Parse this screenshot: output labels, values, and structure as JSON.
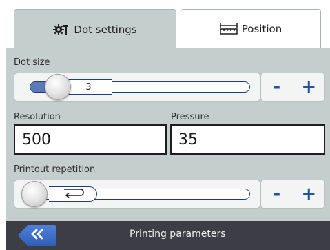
{
  "tabs": [
    {
      "label": "Dot settings",
      "icon": "gears-icon",
      "active": true
    },
    {
      "label": "Position",
      "icon": "ruler-icon",
      "active": false
    }
  ],
  "dot_size": {
    "label": "Dot size",
    "value": "3",
    "minus_label": "-",
    "plus_label": "+"
  },
  "resolution": {
    "label": "Resolution",
    "value": "500"
  },
  "pressure": {
    "label": "Pressure",
    "value": "35"
  },
  "printout_repetition": {
    "label": "Printout repetition",
    "value_icon": "repeat-icon",
    "minus_label": "-",
    "plus_label": "+"
  },
  "footer": {
    "back_icon": "double-chevron-left-icon",
    "title": "Printing parameters"
  },
  "colors": {
    "panel": "#c4cfcd",
    "accent": "#2450a2",
    "footer": "#3d3d46"
  }
}
